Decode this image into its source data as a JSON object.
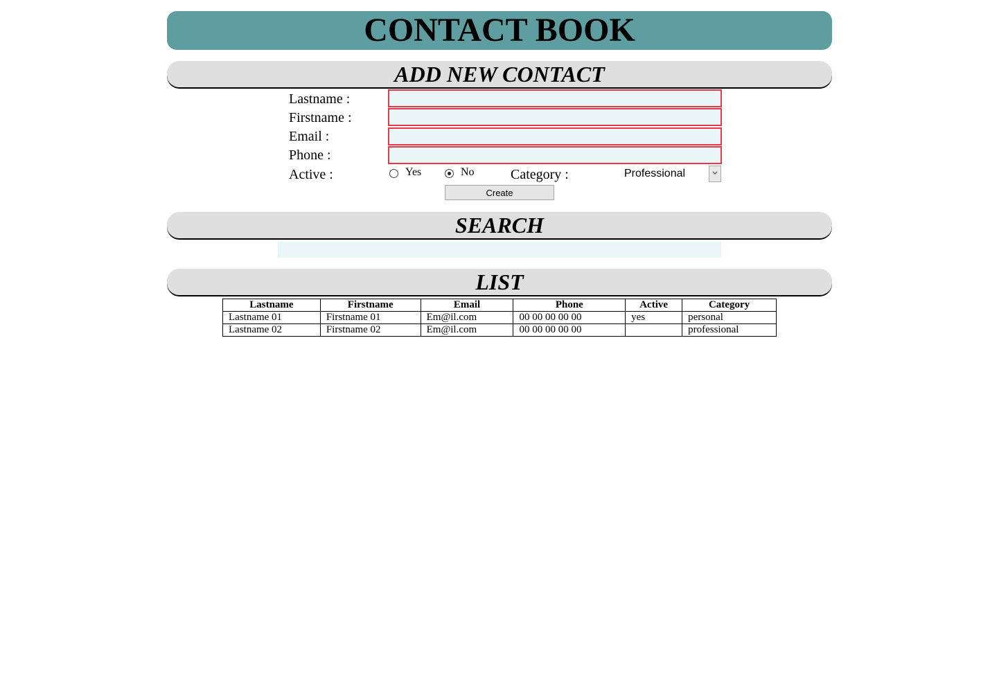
{
  "header": {
    "title": "CONTACT BOOK"
  },
  "add_section": {
    "title": "ADD NEW CONTACT",
    "fields": {
      "lastname": {
        "label": "Lastname :",
        "value": ""
      },
      "firstname": {
        "label": "Firstname :",
        "value": ""
      },
      "email": {
        "label": "Email :",
        "value": ""
      },
      "phone": {
        "label": "Phone :",
        "value": ""
      }
    },
    "active": {
      "label": "Active :",
      "yes": "Yes",
      "no": "No",
      "selected": "No"
    },
    "category": {
      "label": "Category :",
      "selected": "Professional"
    },
    "create_label": "Create"
  },
  "search_section": {
    "title": "SEARCH",
    "value": ""
  },
  "list_section": {
    "title": "LIST",
    "columns": [
      "Lastname",
      "Firstname",
      "Email",
      "Phone",
      "Active",
      "Category"
    ],
    "rows": [
      [
        "Lastname 01",
        "Firstname 01",
        "Em@il.com",
        "00 00 00 00 00",
        "yes",
        "personal"
      ],
      [
        "Lastname 02",
        "Firstname 02",
        "Em@il.com",
        "00 00 00 00 00",
        "",
        "professional"
      ]
    ]
  },
  "colors": {
    "banner": "#5f9ea0",
    "section_header": "#dfdfdf",
    "input_bg": "#e9f5f6",
    "input_border": "#e23a4a"
  },
  "icons": {
    "select_arrow": "chevron-down-icon"
  }
}
